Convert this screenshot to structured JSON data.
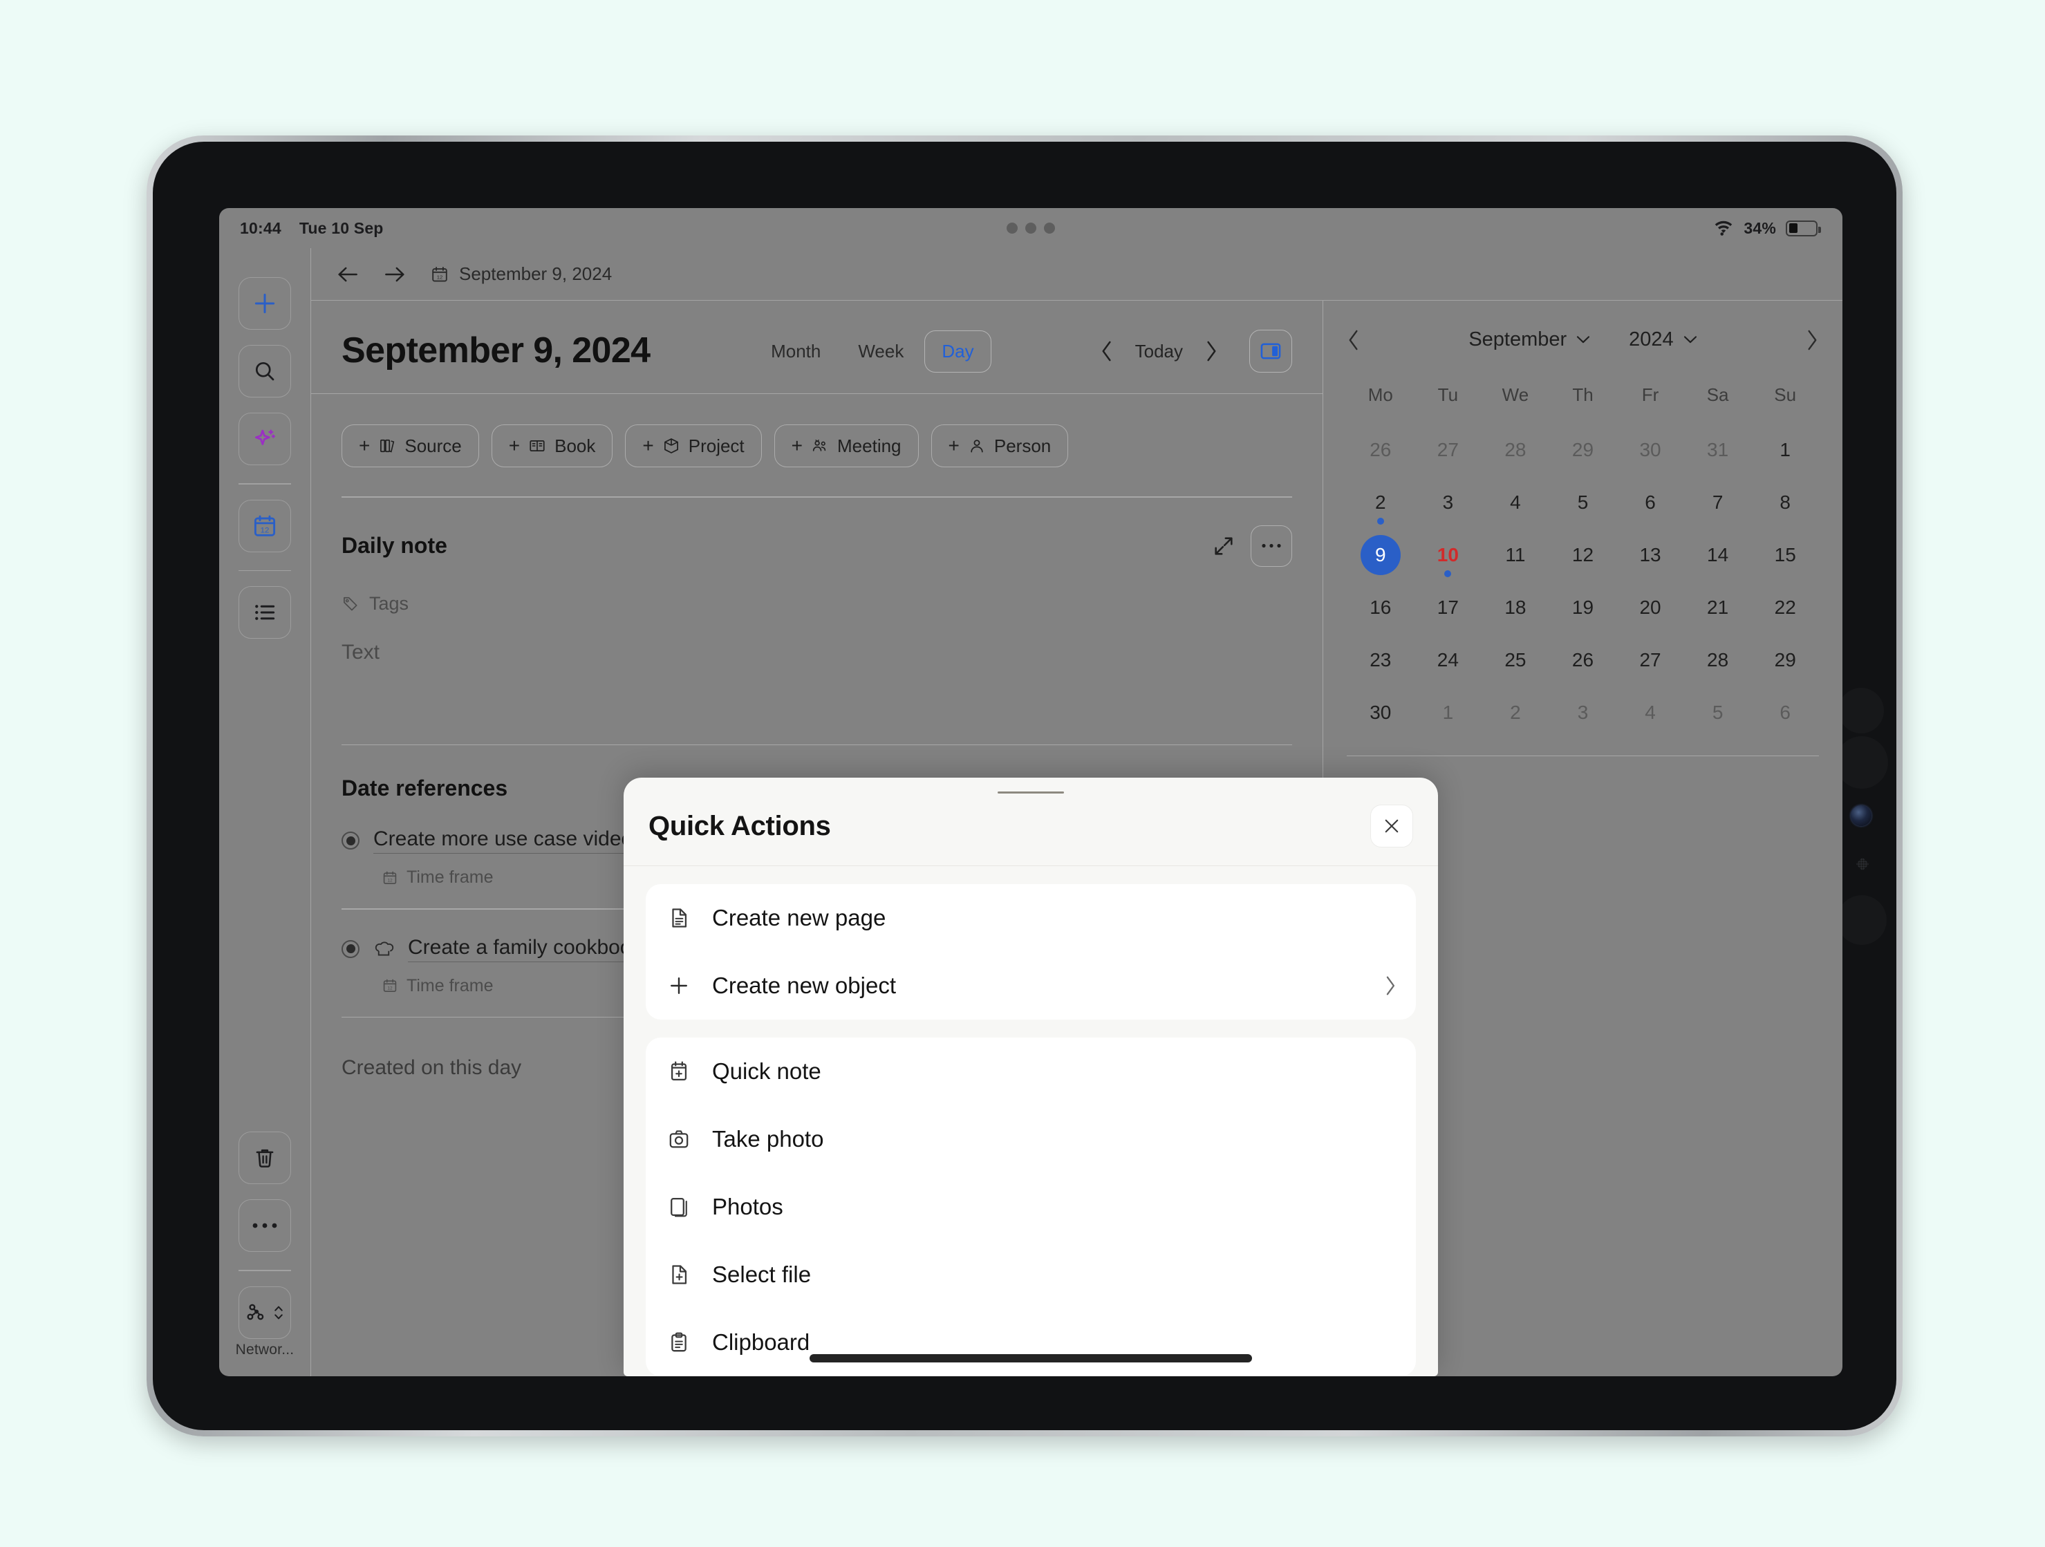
{
  "status_bar": {
    "time": "10:44",
    "date": "Tue 10 Sep",
    "battery_percent": "34%",
    "wifi_icon": "wifi-icon",
    "battery_icon": "battery-icon"
  },
  "left_rail": {
    "items": [
      {
        "name": "create-new",
        "icon": "plus-icon"
      },
      {
        "name": "search",
        "icon": "search-icon"
      },
      {
        "name": "ai-assistant",
        "icon": "sparkle-icon"
      },
      {
        "name": "calendar",
        "icon": "calendar-12-icon"
      },
      {
        "name": "all-objects",
        "icon": "list-icon"
      },
      {
        "name": "bin",
        "icon": "trash-icon"
      },
      {
        "name": "more",
        "icon": "ellipsis-icon"
      },
      {
        "name": "network",
        "icon": "graph-icon"
      }
    ],
    "network_label": "Networ..."
  },
  "breadcrumb": {
    "back_icon": "arrow-left-icon",
    "forward_icon": "arrow-right-icon",
    "page_icon": "calendar-12-icon",
    "label": "September 9, 2024"
  },
  "doc": {
    "title": "September 9, 2024",
    "views": [
      {
        "label": "Month",
        "active": false
      },
      {
        "label": "Week",
        "active": false
      },
      {
        "label": "Day",
        "active": true
      }
    ],
    "prev_icon": "chevron-left-icon",
    "today_label": "Today",
    "next_icon": "chevron-right-icon",
    "panel_toggle_icon": "sidebar-panel-icon",
    "chips": [
      {
        "label": "Source",
        "icon": "books-icon"
      },
      {
        "label": "Book",
        "icon": "open-book-icon"
      },
      {
        "label": "Project",
        "icon": "cube-icon"
      },
      {
        "label": "Meeting",
        "icon": "people-icon"
      },
      {
        "label": "Person",
        "icon": "person-icon"
      }
    ],
    "daily_note": {
      "title": "Daily note",
      "expand_icon": "expand-icon",
      "more_icon": "ellipsis-icon",
      "tags_label": "Tags",
      "tags_icon": "tag-icon",
      "text_placeholder": "Text"
    },
    "date_references": {
      "title": "Date references",
      "items": [
        {
          "title": "Create more use case videos",
          "emoji": "",
          "sub_label": "Time frame",
          "sub_icon": "calendar-12-icon",
          "radio_icon": "radio-selected-icon"
        },
        {
          "title": "Create a family cookbook",
          "emoji": "chef-hat-icon",
          "sub_label": "Time frame",
          "sub_icon": "calendar-12-icon",
          "radio_icon": "radio-selected-icon"
        }
      ]
    },
    "created_on_this_day": "Created on this day"
  },
  "calendar": {
    "prev_icon": "chevron-left-icon",
    "next_icon": "chevron-right-icon",
    "month": "September",
    "year": "2024",
    "dow": [
      "Mo",
      "Tu",
      "We",
      "Th",
      "Fr",
      "Sa",
      "Su"
    ],
    "weeks": [
      [
        {
          "d": "26",
          "muted": true
        },
        {
          "d": "27",
          "muted": true
        },
        {
          "d": "28",
          "muted": true
        },
        {
          "d": "29",
          "muted": true
        },
        {
          "d": "30",
          "muted": true
        },
        {
          "d": "31",
          "muted": true
        },
        {
          "d": "1",
          "muted": false
        }
      ],
      [
        {
          "d": "2",
          "muted": false,
          "dot": true
        },
        {
          "d": "3",
          "muted": false
        },
        {
          "d": "4",
          "muted": false
        },
        {
          "d": "5",
          "muted": false
        },
        {
          "d": "6",
          "muted": false
        },
        {
          "d": "7",
          "muted": false
        },
        {
          "d": "8",
          "muted": false
        }
      ],
      [
        {
          "d": "9",
          "muted": false,
          "selected": true
        },
        {
          "d": "10",
          "muted": false,
          "today": true,
          "dot": true
        },
        {
          "d": "11",
          "muted": false
        },
        {
          "d": "12",
          "muted": false
        },
        {
          "d": "13",
          "muted": false
        },
        {
          "d": "14",
          "muted": false
        },
        {
          "d": "15",
          "muted": false
        }
      ],
      [
        {
          "d": "16",
          "muted": false
        },
        {
          "d": "17",
          "muted": false
        },
        {
          "d": "18",
          "muted": false
        },
        {
          "d": "19",
          "muted": false
        },
        {
          "d": "20",
          "muted": false
        },
        {
          "d": "21",
          "muted": false
        },
        {
          "d": "22",
          "muted": false
        }
      ],
      [
        {
          "d": "23",
          "muted": false
        },
        {
          "d": "24",
          "muted": false
        },
        {
          "d": "25",
          "muted": false
        },
        {
          "d": "26",
          "muted": false
        },
        {
          "d": "27",
          "muted": false
        },
        {
          "d": "28",
          "muted": false
        },
        {
          "d": "29",
          "muted": false
        }
      ],
      [
        {
          "d": "30",
          "muted": false
        },
        {
          "d": "1",
          "muted": true
        },
        {
          "d": "2",
          "muted": true
        },
        {
          "d": "3",
          "muted": true
        },
        {
          "d": "4",
          "muted": true
        },
        {
          "d": "5",
          "muted": true
        },
        {
          "d": "6",
          "muted": true
        }
      ]
    ]
  },
  "sheet": {
    "title": "Quick Actions",
    "close_icon": "close-icon",
    "groups": [
      {
        "items": [
          {
            "label": "Create new page",
            "icon": "document-icon",
            "chevron": false
          },
          {
            "label": "Create new object",
            "icon": "plus-icon",
            "chevron": true
          }
        ]
      },
      {
        "items": [
          {
            "label": "Quick note",
            "icon": "note-plus-icon",
            "chevron": false
          },
          {
            "label": "Take photo",
            "icon": "camera-icon",
            "chevron": false
          },
          {
            "label": "Photos",
            "icon": "photos-icon",
            "chevron": false
          },
          {
            "label": "Select file",
            "icon": "file-plus-icon",
            "chevron": false
          },
          {
            "label": "Clipboard",
            "icon": "clipboard-icon",
            "chevron": false
          }
        ]
      }
    ]
  },
  "colors": {
    "accent_blue": "#2a5fc7",
    "today_red": "#d12b2b",
    "ai_purple": "#9b2fc4",
    "page_bg": "#edfbf7",
    "screen_bg": "#828282",
    "sheet_bg": "#f7f7f5"
  }
}
